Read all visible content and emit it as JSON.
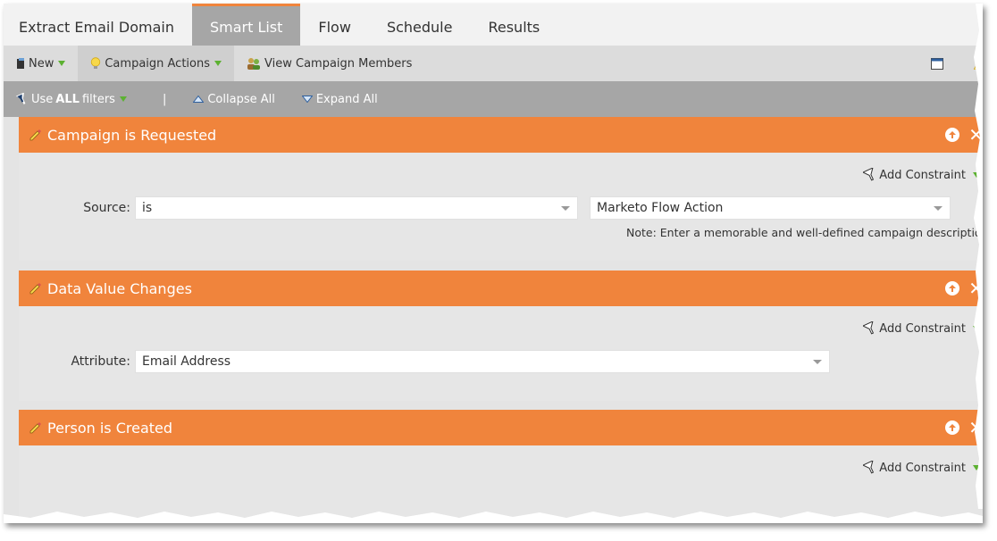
{
  "tabs": [
    {
      "label": "Extract Email Domain",
      "active": false
    },
    {
      "label": "Smart List",
      "active": true
    },
    {
      "label": "Flow",
      "active": false
    },
    {
      "label": "Schedule",
      "active": false
    },
    {
      "label": "Results",
      "active": false
    }
  ],
  "toolbar": {
    "new_label": "New",
    "campaign_actions_label": "Campaign Actions",
    "view_members_label": "View Campaign Members"
  },
  "filterbar": {
    "use_prefix": "Use",
    "use_bold": "ALL",
    "use_suffix": "filters",
    "separator": "|",
    "collapse_label": "Collapse All",
    "expand_label": "Expand All"
  },
  "filters": [
    {
      "title": "Campaign is Requested",
      "add_constraint": "Add Constraint",
      "field_label": "Source:",
      "operator_value": "is",
      "value": "Marketo Flow Action",
      "note": "Note: Enter a memorable and well-defined campaign description"
    },
    {
      "title": "Data Value Changes",
      "add_constraint": "Add Constraint",
      "field_label": "Attribute:",
      "value": "Email Address"
    },
    {
      "title": "Person is Created",
      "add_constraint": "Add Constraint"
    }
  ],
  "colors": {
    "accent_orange": "#f0843c",
    "caret_green": "#5cb131",
    "tab_active_bg": "#a6a6a6"
  }
}
